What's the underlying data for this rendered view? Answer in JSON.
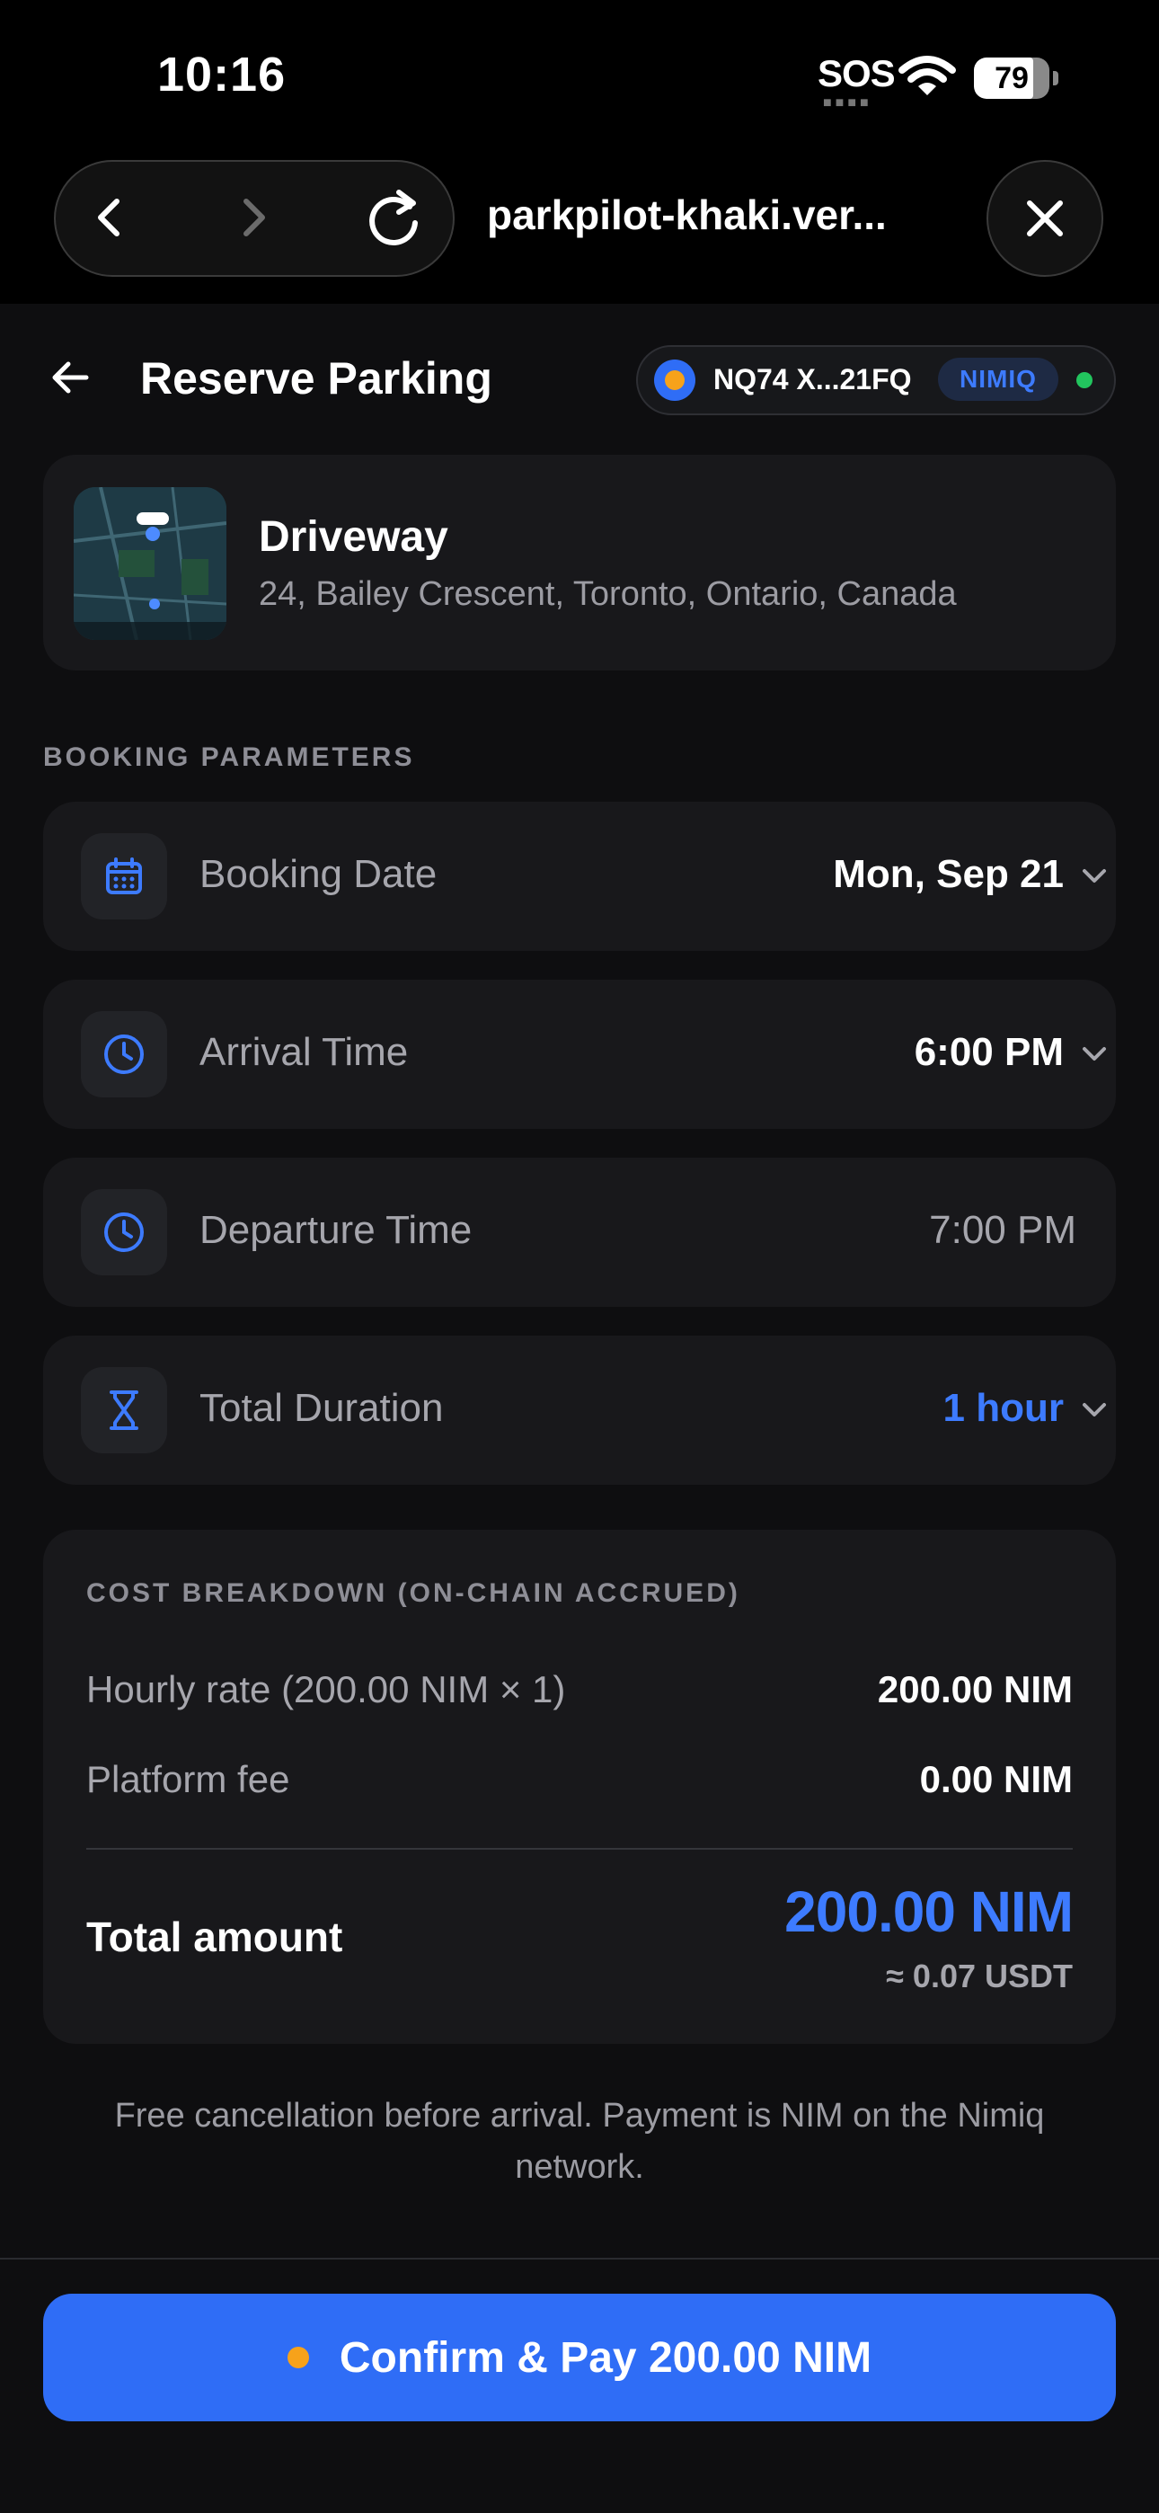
{
  "status_bar": {
    "time": "10:16",
    "carrier": "SOS",
    "battery_level": "79",
    "battery_fraction": 0.79
  },
  "browser": {
    "url": "parkpilot-khaki.ver..."
  },
  "header": {
    "title": "Reserve Parking",
    "wallet_address": "NQ74 X...21FQ",
    "network": "NIMIQ"
  },
  "location": {
    "name": "Driveway",
    "address": "24, Bailey Crescent, Toronto, Ontario, Canada"
  },
  "booking": {
    "section_label": "BOOKING PARAMETERS",
    "rows": [
      {
        "label": "Booking Date",
        "value": "Mon, Sep 21",
        "icon": "calendar-icon"
      },
      {
        "label": "Arrival Time",
        "value": "6:00 PM",
        "icon": "clock-icon"
      },
      {
        "label": "Departure Time",
        "value": "7:00 PM",
        "icon": "clock-icon"
      },
      {
        "label": "Total Duration",
        "value": "1 hour",
        "icon": "hourglass-icon"
      }
    ]
  },
  "cost": {
    "section_label": "COST BREAKDOWN (ON-CHAIN ACCRUED)",
    "lines": [
      {
        "label": "Hourly rate (200.00 NIM × 1)",
        "value": "200.00 NIM"
      },
      {
        "label": "Platform fee",
        "value": "0.00 NIM"
      }
    ],
    "total_label": "Total amount",
    "total_value": "200.00 NIM",
    "total_usdt": "≈ 0.07 USDT"
  },
  "footnote": "Free cancellation before arrival. Payment is NIM on the Nimiq network.",
  "confirm_button": "Confirm & Pay 200.00 NIM",
  "colors": {
    "accent": "#2f6df6",
    "accent_text": "#3d7bff",
    "nim_gold": "#f7a21a",
    "online": "#22c55e",
    "card": "#18181b",
    "background": "#0e0e10"
  }
}
